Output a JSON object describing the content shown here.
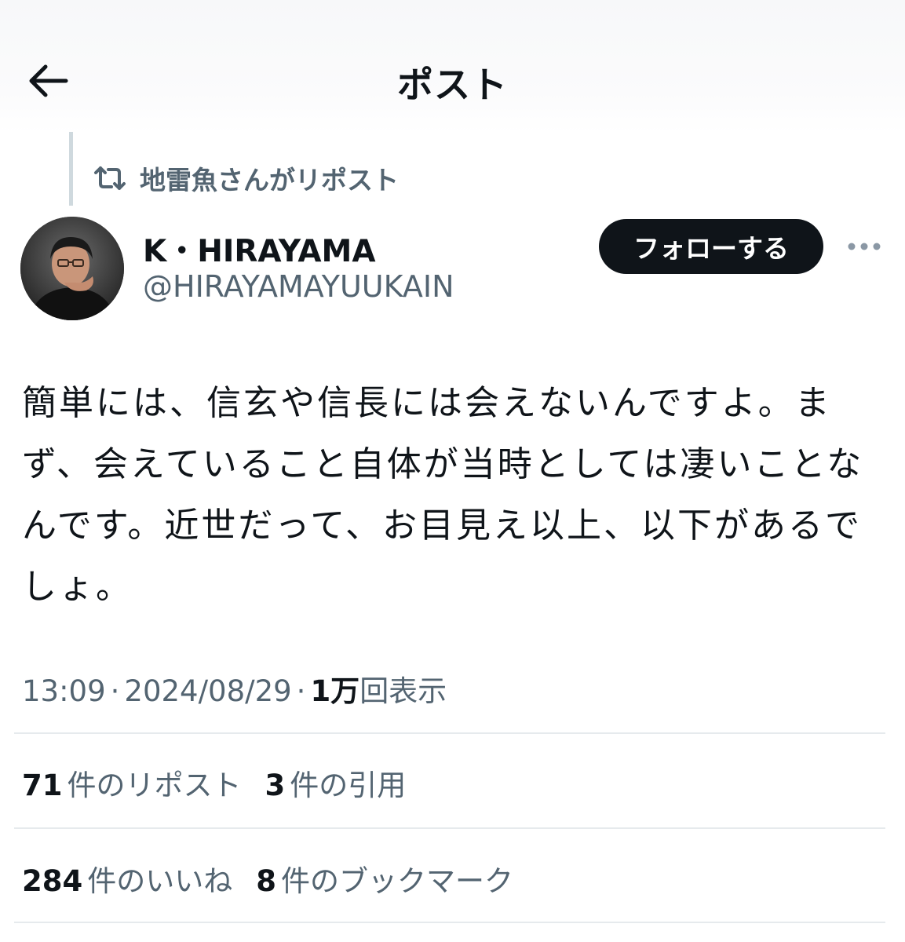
{
  "header": {
    "title": "ポスト",
    "back_icon": "arrow-left-icon"
  },
  "repost": {
    "icon": "repost-icon",
    "text": "地雷魚さんがリポスト"
  },
  "author": {
    "display_name": "K・HIRAYAMA",
    "handle": "@HIRAYAMAYUUKAIN",
    "follow_label": "フォローする",
    "more_icon": "more-icon"
  },
  "post": {
    "text": "簡単には、信玄や信長には会えないんですよ。まず、会えていること自体が当時としては凄いことなんです。近世だって、お目見え以上、以下があるでしょ。",
    "time": "13:09",
    "date": "2024/08/29",
    "views_count": "1万",
    "views_label": "回表示"
  },
  "stats": {
    "reposts": {
      "count": "71",
      "label": "件のリポスト"
    },
    "quotes": {
      "count": "3",
      "label": "件の引用"
    },
    "likes": {
      "count": "284",
      "label": "件のいいね"
    },
    "bookmarks": {
      "count": "8",
      "label": "件のブックマーク"
    }
  },
  "colors": {
    "text": "#0f1419",
    "secondary": "#536471",
    "button_bg": "#0f1419",
    "divider": "#e6eaed"
  }
}
